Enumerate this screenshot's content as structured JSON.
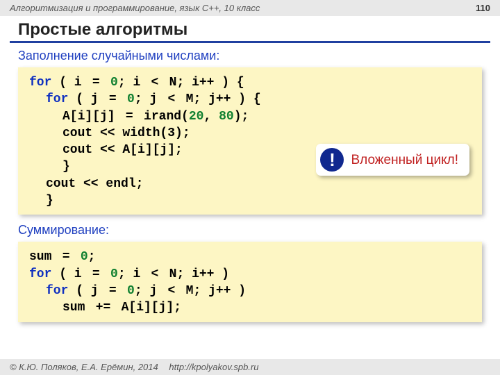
{
  "header": {
    "course": "Алгоритмизация и программирование, язык C++, 10 класс",
    "page_number": "110"
  },
  "title": "Простые алгоритмы",
  "section1": {
    "label": "Заполнение случайными числами:",
    "code": {
      "l1a": "for",
      "l1b": " ( i",
      "l1c": " =",
      "l1d": " 0",
      "l1e": "; i",
      "l1f": " <",
      "l1g": " N; i++ ) {",
      "l2a": "for",
      "l2b": " ( j",
      "l2c": " =",
      "l2d": " 0",
      "l2e": "; j",
      "l2f": " <",
      "l2g": " M; j++ ) {",
      "l3a": "A[i][j]",
      "l3b": " =",
      "l3c": " irand(",
      "l3d": "20",
      "l3e": ", ",
      "l3f": "80",
      "l3g": ");",
      "l4": "cout << width(3);",
      "l5": "cout << A[i][j];",
      "l6": "}",
      "l7": "cout << endl;",
      "l8": "}"
    },
    "callout": {
      "badge": "!",
      "text": "Вложенный цикл!"
    }
  },
  "section2": {
    "label": "Суммирование:",
    "code": {
      "l1a": "sum",
      "l1b": " =",
      "l1c": " 0",
      "l1d": ";",
      "l2a": "for",
      "l2b": " ( i",
      "l2c": " =",
      "l2d": " 0",
      "l2e": "; i",
      "l2f": " <",
      "l2g": " N; i++ )",
      "l3a": "for",
      "l3b": " ( j",
      "l3c": " =",
      "l3d": " 0",
      "l3e": "; j",
      "l3f": " <",
      "l3g": " M; j++ )",
      "l4a": "sum",
      "l4b": " +=",
      "l4c": " A[i][j];"
    }
  },
  "footer": {
    "copyright": "© К.Ю. Поляков, Е.А. Ерёмин, 2014",
    "url": "http://kpolyakov.spb.ru"
  }
}
